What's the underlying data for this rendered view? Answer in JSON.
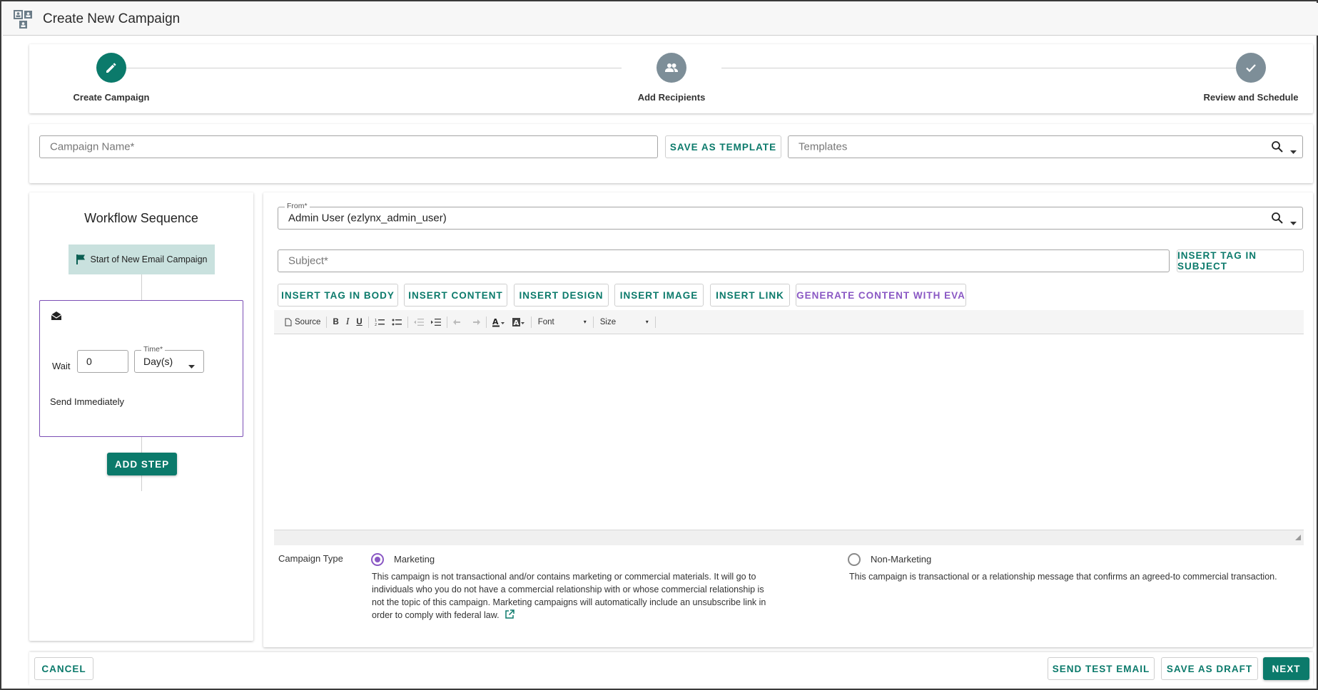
{
  "header": {
    "title": "Create New Campaign",
    "icon": "campaign-org-icon"
  },
  "stepper": {
    "steps": [
      {
        "label": "Create Campaign",
        "state": "active",
        "icon": "pencil-icon"
      },
      {
        "label": "Add Recipients",
        "state": "inactive",
        "icon": "people-icon"
      },
      {
        "label": "Review and Schedule",
        "state": "inactive",
        "icon": "check-icon"
      }
    ]
  },
  "campaign": {
    "name_placeholder": "Campaign Name*",
    "save_template_label": "SAVE AS TEMPLATE",
    "templates_placeholder": "Templates"
  },
  "workflow": {
    "title": "Workflow Sequence",
    "start_label": "Start of New Email Campaign",
    "wait_label": "Wait",
    "wait_value": "0",
    "time_label": "Time*",
    "time_value": "Day(s)",
    "send_label": "Send Immediately",
    "add_step_label": "ADD STEP"
  },
  "editor": {
    "from_label": "From*",
    "from_value": "Admin User (ezlynx_admin_user)",
    "subject_placeholder": "Subject*",
    "insert_tag_subject_label": "INSERT TAG IN SUBJECT",
    "action_buttons": [
      "INSERT TAG IN BODY",
      "INSERT CONTENT",
      "INSERT DESIGN",
      "INSERT IMAGE",
      "INSERT LINK",
      "GENERATE CONTENT WITH EVA"
    ],
    "toolbar": {
      "source": "Source",
      "bold": "B",
      "italic": "I",
      "underline": "U",
      "font": "Font",
      "size": "Size"
    }
  },
  "campaign_type": {
    "label": "Campaign Type",
    "selected": "Marketing",
    "options": [
      {
        "label": "Marketing",
        "description": "This campaign is not transactional and/or contains marketing or commercial materials. It will go to individuals who you do not have a commercial relationship with or whose commercial relationship is not the topic of this campaign. Marketing campaigns will automatically include an unsubscribe link in order to comply with federal law."
      },
      {
        "label": "Non-Marketing",
        "description": "This campaign is transactional or a relationship message that confirms an agreed-to commercial transaction."
      }
    ]
  },
  "footer": {
    "cancel_label": "CANCEL",
    "send_test_label": "SEND TEST EMAIL",
    "save_draft_label": "SAVE AS DRAFT",
    "next_label": "NEXT"
  },
  "colors": {
    "primary": "#0b7a6b",
    "accent_purple": "#8a58c4",
    "inactive_step": "#7d8e98",
    "start_chip": "#c9e1de"
  }
}
